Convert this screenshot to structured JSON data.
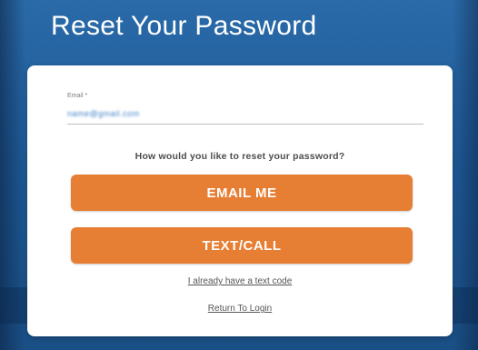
{
  "header": {
    "title": "Reset Your Password"
  },
  "form": {
    "email_label": "Email *",
    "email_value": "name@gmail.com"
  },
  "prompt": {
    "question": "How would you like to reset your password?"
  },
  "actions": {
    "email_me_label": "EMAIL ME",
    "text_call_label": "TEXT/CALL"
  },
  "links": {
    "have_code": "I already have a text code",
    "return_login": "Return To Login"
  },
  "colors": {
    "background": "#1f5f9b",
    "button": "#e67e33",
    "card": "#ffffff"
  }
}
